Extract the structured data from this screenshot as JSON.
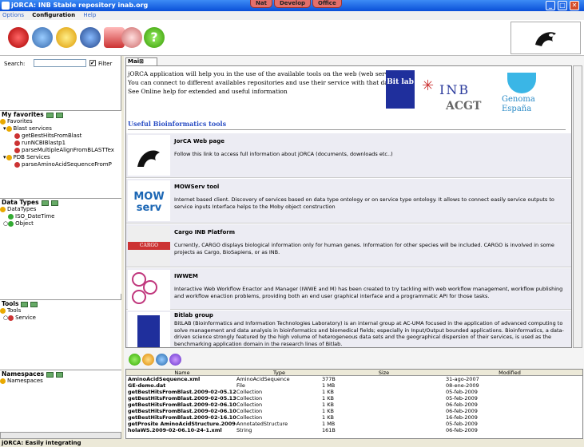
{
  "window": {
    "title": "jORCA: INB Stable repository inab.org",
    "top_buttons": [
      "Nat",
      "Develop",
      "Office"
    ]
  },
  "menu": [
    "Options",
    "Configuration",
    "Help"
  ],
  "search": {
    "label": "Search:",
    "filter": "Filter"
  },
  "favorites": {
    "header": "My favorites",
    "items": [
      "Favorites",
      "Blast services",
      "getBestHitsFromBlast",
      "runNCBIBlastp1",
      "parseMultipleAlignFromBLASTTex",
      "PDB Services",
      "parseAminoAcidSequenceFromP"
    ]
  },
  "datatypes": {
    "header": "Data Types",
    "items": [
      "DataTypes",
      "ISO_DateTime",
      "Object"
    ]
  },
  "tools": {
    "header": "Tools",
    "items": [
      "Tools",
      "Service"
    ]
  },
  "namespaces": {
    "header": "Namespaces",
    "items": [
      "Namespaces"
    ]
  },
  "main_tab": "Mai",
  "intro": [
    "jORCA application will help you in the use of the available tools on the web (web services).",
    "You can connect to different availables repositories and use their service with that data.",
    "See Online help for extended and useful information"
  ],
  "useful_header": "Useful Bioinformatics tools",
  "logos": {
    "bitlab": "Bit lab",
    "inb": "INB",
    "acgt": "ACGT",
    "genoma": "Genoma España"
  },
  "tools_list": [
    {
      "title": "JorCA Web page",
      "desc": "Follow this link to access full information about jORCA (documents, downloads etc..)"
    },
    {
      "title": "MOWServ tool",
      "desc": "Internet based client. Discovery of services based on data type ontology or on service type ontology. It allows to connect easily service outputs to service inputs Interface helps to the Moby object construction"
    },
    {
      "title": "Cargo INB Platform",
      "desc": "Currently, CARGO displays biological information only for human genes. Information for other species will be included. CARGO is involved in some projects as Cargo, BioSapiens, or as INB."
    },
    {
      "title": "IWWEM",
      "desc": "Interactive Web Workflow Enactor and Manager (IWWE and M) has been created to try tackling with web workflow management, workflow publishing and workflow enaction problems, providing both an end user graphical interface and a programmatic API for those tasks."
    },
    {
      "title": "Bitlab group",
      "desc": "BitLAB (Bioinformatics and Information Technologies Laboratory) is an internal group at AC-UMA focused in the application of advanced computing to solve management and data analysis in bioinformatics and biomedical fields; especially in Input/Output bounded applications. Bioinformatics, a data-driven science strongly featured by the high volume of heterogeneous data sets and the geographical dispersion of their services, is used as the benchmarking application domain in the research lines of Bitlab."
    }
  ],
  "files": {
    "columns": [
      "Name",
      "Type",
      "Size",
      "Modified"
    ],
    "rows": [
      [
        "AminoAcidSequence.xml",
        "AminoAcidSequence",
        "377B",
        "31-ago-2007"
      ],
      [
        "GE-demo.dat",
        "File",
        "1 MB",
        "08-ene-2009"
      ],
      [
        "getBestHitsFromBlast.2009-02-05.12-5...",
        "Collection",
        "1 KB",
        "05-feb-2009"
      ],
      [
        "getBestHitsFromBlast.2009-02-05.13-1...",
        "Collection",
        "1 KB",
        "05-feb-2009"
      ],
      [
        "getBestHitsFromBlast.2009-02-06.10-3...",
        "Collection",
        "1 KB",
        "06-feb-2009"
      ],
      [
        "getBestHitsFromBlast.2009-02-06.10-4...",
        "Collection",
        "1 KB",
        "06-feb-2009"
      ],
      [
        "getBestHitsFromBlast.2009-02-16.10-5...",
        "Collection",
        "1 KB",
        "16-feb-2009"
      ],
      [
        "getProsite AminoAcidStructure.2009-02-05.13...",
        "AnnotatedStructure",
        "1 MB",
        "05-feb-2009"
      ],
      [
        "holaWS.2009-02-06.10-24-1.xml",
        "String",
        "161B",
        "06-feb-2009"
      ]
    ]
  },
  "status": "jORCA: Easily integrating"
}
